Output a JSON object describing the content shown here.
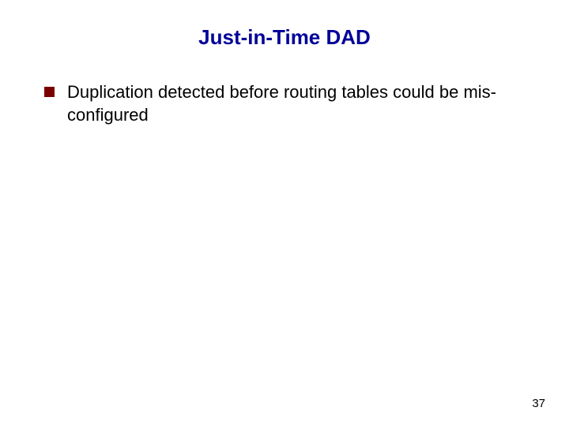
{
  "title": "Just-in-Time DAD",
  "bullets": [
    {
      "text": "Duplication detected before routing tables could be mis-configured"
    }
  ],
  "page_number": "37"
}
